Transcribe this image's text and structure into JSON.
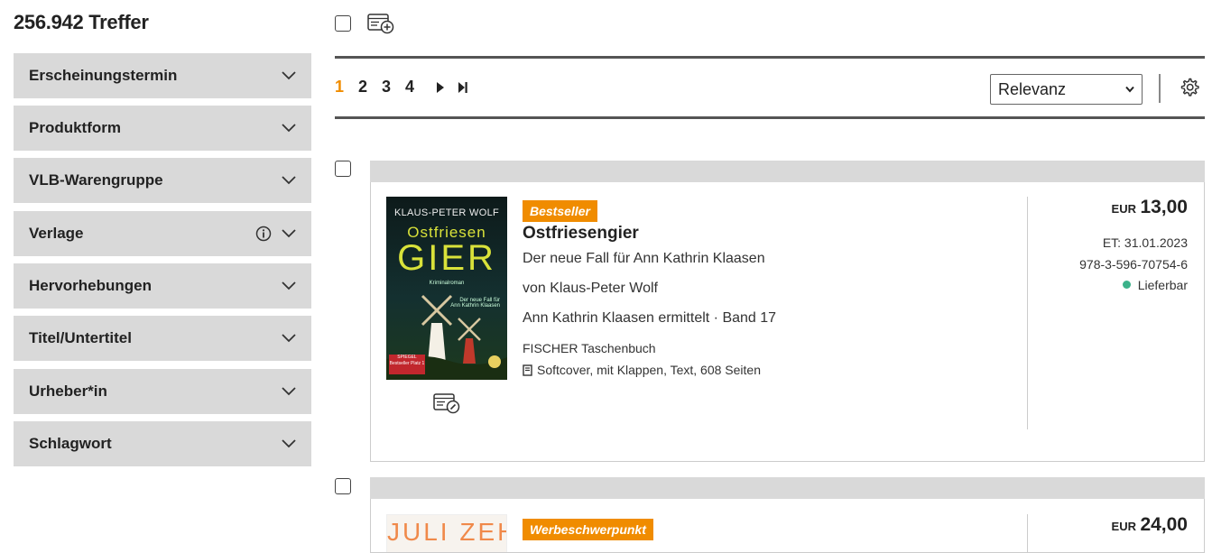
{
  "results": {
    "count_label": "256.942 Treffer"
  },
  "facets": [
    {
      "label": "Erscheinungstermin"
    },
    {
      "label": "Produktform"
    },
    {
      "label": "VLB-Warengruppe"
    },
    {
      "label": "Verlage",
      "info": true
    },
    {
      "label": "Hervorhebungen"
    },
    {
      "label": "Titel/Untertitel"
    },
    {
      "label": "Urheber*in"
    },
    {
      "label": "Schlagwort"
    }
  ],
  "pagination": {
    "pages": [
      "1",
      "2",
      "3",
      "4"
    ],
    "current": "1"
  },
  "sort": {
    "selected": "Relevanz"
  },
  "colors": {
    "accent": "#f08c00",
    "facet_bg": "#d9d9d9",
    "available": "#3bb28a"
  },
  "items": [
    {
      "badge": "Bestseller",
      "title": "Ostfriesengier",
      "subtitle": "Der neue Fall für Ann Kathrin Klaasen",
      "author": "von Klaus-Peter Wolf",
      "series": "Ann Kathrin Klaasen ermittelt · Band 17",
      "publisher": "FISCHER Taschenbuch",
      "format": "Softcover, mit Klappen, Text, 608 Seiten",
      "currency": "EUR",
      "price": "13,00",
      "release": "ET: 31.01.2023",
      "isbn": "978-3-596-70754-6",
      "availability": "Lieferbar",
      "cover": {
        "author": "KLAUS-PETER WOLF",
        "title_top": "Ostfriesen",
        "title_big": "GIER",
        "genre": "Kriminalroman",
        "blurb": "Der neue Fall für Ann Kathrin Klaasen",
        "sticker": "SPIEGEL Bestseller Platz 1"
      }
    },
    {
      "badge": "Werbeschwerpunkt",
      "currency": "EUR",
      "price": "24,00",
      "cover": {
        "title_big": "JULI ZEH"
      }
    }
  ]
}
